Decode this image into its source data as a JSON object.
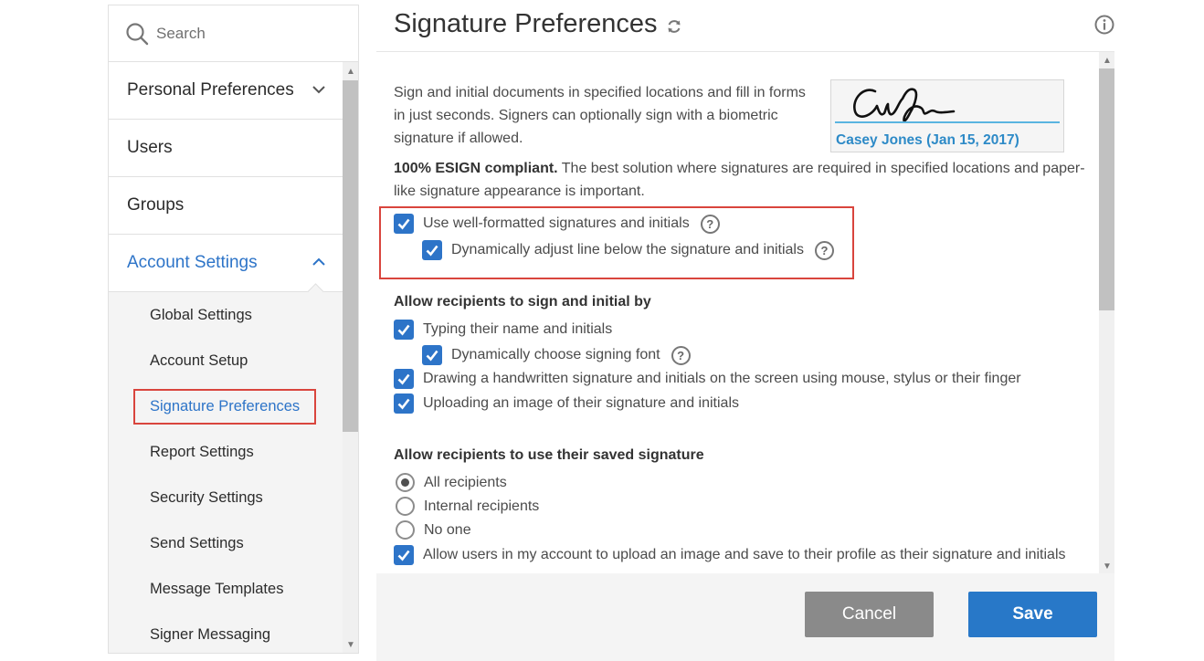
{
  "search": {
    "placeholder": "Search",
    "icon": "search-icon"
  },
  "nav": {
    "personal_preferences": "Personal Preferences",
    "users": "Users",
    "groups": "Groups",
    "account_settings": "Account Settings"
  },
  "subnav": [
    {
      "label": "Global Settings"
    },
    {
      "label": "Account Setup"
    },
    {
      "label": "Signature Preferences",
      "current": true
    },
    {
      "label": "Report Settings"
    },
    {
      "label": "Security Settings"
    },
    {
      "label": "Send Settings"
    },
    {
      "label": "Message Templates"
    },
    {
      "label": "Signer Messaging"
    }
  ],
  "page": {
    "title": "Signature Preferences",
    "description": "Sign and initial documents in specified locations and fill in forms in just seconds. Signers can optionally sign with a biometric signature if allowed.",
    "sample_signature_name": "Casey Jones (Jan 15, 2017)",
    "esign_bold": "100% ESIGN compliant.",
    "esign_text": " The best solution where signatures are required in specified locations and paper-like signature appearance is important."
  },
  "options": {
    "well_formatted": {
      "label": "Use well-formatted signatures and initials",
      "checked": true
    },
    "adjust_line": {
      "label": "Dynamically adjust line below the signature and initials",
      "checked": true
    }
  },
  "sign_by": {
    "title": "Allow recipients to sign and initial by",
    "typing": {
      "label": "Typing their name and initials",
      "checked": true
    },
    "signing_font": {
      "label": "Dynamically choose signing font",
      "checked": true
    },
    "drawing": {
      "label": "Drawing a handwritten signature and initials on the screen using mouse, stylus or their finger",
      "checked": true
    },
    "uploading": {
      "label": "Uploading an image of their signature and initials",
      "checked": true
    }
  },
  "saved_signature": {
    "title": "Allow recipients to use their saved signature",
    "radios": [
      {
        "label": "All recipients",
        "selected": true
      },
      {
        "label": "Internal recipients",
        "selected": false
      },
      {
        "label": "No one",
        "selected": false
      }
    ],
    "upload_image": {
      "label": "Allow users in my account to upload an image and save to their profile as their signature and initials",
      "checked": true
    }
  },
  "footer": {
    "cancel": "Cancel",
    "save": "Save"
  },
  "colors": {
    "accent": "#2d74c8",
    "highlight": "#d9453d",
    "cancel": "#8a8a8a",
    "save": "#2878c8"
  }
}
